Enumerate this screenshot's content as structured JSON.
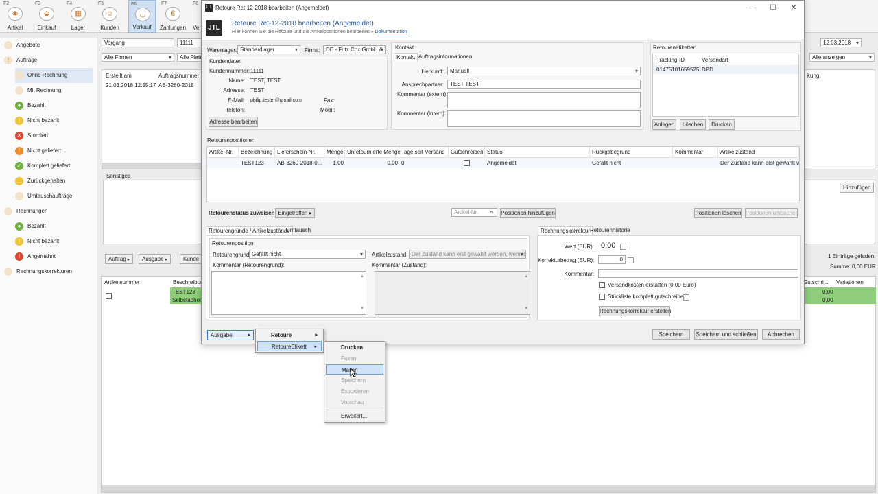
{
  "toolbar": {
    "items": [
      {
        "key": "F2",
        "label": "Artikel",
        "icon": "artikel-icon"
      },
      {
        "key": "F3",
        "label": "Einkauf",
        "icon": "einkauf-icon"
      },
      {
        "key": "F4",
        "label": "Lager",
        "icon": "lager-icon"
      },
      {
        "key": "F5",
        "label": "Kunden",
        "icon": "kunden-icon"
      },
      {
        "key": "F6",
        "label": "Verkauf",
        "icon": "verkauf-icon"
      },
      {
        "key": "F7",
        "label": "Zahlungen",
        "icon": "zahlungen-icon"
      },
      {
        "key": "F8",
        "label": "Ve",
        "icon": "versand-icon"
      }
    ]
  },
  "nav": {
    "items": [
      {
        "label": "Angebote",
        "color": "#e8a23a",
        "glyph": ""
      },
      {
        "label": "Aufträge",
        "color": "#e8a23a",
        "glyph": "!"
      },
      {
        "label": "Ohne Rechnung",
        "color": "#e8a23a",
        "glyph": ""
      },
      {
        "label": "Mit Rechnung",
        "color": "#e8a23a",
        "glyph": ""
      },
      {
        "label": "Bezahlt",
        "color": "#6fb23b",
        "glyph": "●"
      },
      {
        "label": "Nicht bezahlt",
        "color": "#f2c230",
        "glyph": "!"
      },
      {
        "label": "Storniert",
        "color": "#e0452f",
        "glyph": "✕"
      },
      {
        "label": "Nicht geliefert",
        "color": "#f08a24",
        "glyph": "!"
      },
      {
        "label": "Komplett geliefert",
        "color": "#6fb23b",
        "glyph": "✓"
      },
      {
        "label": "Zurückgehalten",
        "color": "#f2c230",
        "glyph": "…"
      },
      {
        "label": "Umtauschaufträge",
        "color": "#e8a23a",
        "glyph": ""
      },
      {
        "label": "Rechnungen",
        "color": "#e8a23a",
        "glyph": ""
      },
      {
        "label": "Bezahlt",
        "color": "#6fb23b",
        "glyph": "●"
      },
      {
        "label": "Nicht bezahlt",
        "color": "#f2c230",
        "glyph": "!"
      },
      {
        "label": "Angemahnt",
        "color": "#e0452f",
        "glyph": "!"
      },
      {
        "label": "Rechnungskorrekturen",
        "color": "#e8a23a",
        "glyph": ""
      }
    ]
  },
  "bg": {
    "vorgang": "Vorgang",
    "search_value": "11111",
    "alle_firmen": "Alle Firmen",
    "alle_plattf": "Alle Plattfo",
    "date": "12.03.2018",
    "alle_anzeigen": "Alle anzeigen",
    "col_erstellt": "Erstellt am",
    "col_auftragsnummer": "Auftragsnummer",
    "row_erstellt": "21.03.2018 12:55:17",
    "row_auftragsnummer": "AB-3260-2018",
    "col_right": "kung",
    "sonstiges": "Sonstiges",
    "btn_auftrag": "Auftrag",
    "btn_ausgabe": "Ausgabe",
    "btn_kunde": "Kunde",
    "btn_hinzufuegen": "Hinzufügen",
    "eintraege": "1 Einträge geladen.",
    "summe": "Summe: 0,00 EUR",
    "col_artikelnummer": "Artikelnummer",
    "col_beschreibung": "Beschreibung",
    "col_gutschrift": "Gutschri...",
    "col_variationen": "Variationen",
    "row1_desc": "TEST123",
    "row2_desc": "Selbstabholer",
    "row1_val": "0,00",
    "row2_val": "0,00"
  },
  "dialog": {
    "window_title": "Retoure Ret-12-2018 bearbeiten (Angemeldet)",
    "logo": "JTL",
    "heading": "Retoure Ret-12-2018 bearbeiten (Angemeldet)",
    "subheading": "Hier können Sie die Retoure und die Artikelpositionen bearbeiten  »",
    "doc_link": "Dokumentation",
    "warenlager_label": "Warenlager:",
    "warenlager_value": "Standardlager",
    "firma_label": "Firma:",
    "firma_value": "DE - Fritz Cox GmbH & C",
    "kundendaten": {
      "title": "Kundendaten",
      "kundennummer_label": "Kundennummer:",
      "kundennummer": "11111",
      "name_label": "Name:",
      "name": "TEST, TEST",
      "adresse_label": "Adresse:",
      "adresse": "TEST",
      "email_label": "E-Mail:",
      "email": "philip.tester@gmail.com",
      "telefon_label": "Telefon:",
      "fax_label": "Fax:",
      "mobil_label": "Mobil:",
      "edit_button": "Adresse bearbeiten"
    },
    "kontakt": {
      "title": "Kontakt",
      "tab_kontakt": "Kontakt",
      "tab_auftrag": "Auftragsinformationen",
      "herkunft_label": "Herkunft:",
      "herkunft": "Manuell",
      "ansprech_label": "Ansprechpartner:",
      "ansprech": "TEST TEST",
      "komm_extern_label": "Kommentar (extern):",
      "komm_intern_label": "Kommentar (intern):"
    },
    "etiketten": {
      "title": "Retourenetiketten",
      "col_tracking": "Tracking-ID",
      "col_versandart": "Versandart",
      "tracking": "01475101659525",
      "versandart": "DPD",
      "btn_anlegen": "Anlegen",
      "btn_loeschen": "Löschen",
      "btn_drucken": "Drucken"
    },
    "positionen": {
      "title": "Retourenpositionen",
      "cols": [
        "Artikel-Nr.",
        "Bezeichnung",
        "Lieferschein-Nr.",
        "Menge",
        "Unretournierte Menge",
        "Tage seit Versand",
        "Gutschreiben",
        "Status",
        "Rückgabegrund",
        "Kommentar",
        "Artikelzustand"
      ],
      "row": {
        "artikel": "",
        "bezeichnung": "TEST123",
        "lieferschein": "AB-3260-2018-0...",
        "menge": "1,00",
        "unretourniert": "0,00",
        "tage": "0",
        "status": "Angemeldet",
        "rueckgabegrund": "Gefällt nicht",
        "kommentar": "",
        "zustand": "Der Zustand kann erst gewählt w..."
      },
      "status_label": "Retourenstatus zuweisen:",
      "status_button": "Eingetroffen",
      "artikel_placeholder": "Artikel-Nr.",
      "btn_hinzufuegen": "Positionen hinzufügen",
      "btn_loeschen": "Positionen löschen",
      "btn_zustand": "Positionen umbuchen"
    },
    "gruende": {
      "tab1": "Retourengründe / Artikelzustände",
      "tab2": "Umtausch",
      "group": "Retourenposition",
      "grund_label": "Retourengrund:",
      "grund": "Gefällt nicht",
      "zustand_label": "Artikelzustand:",
      "zustand": "Der Zustand kann erst gewählt werden, wenn der",
      "komm_grund_label": "Kommentar (Retourengrund):",
      "komm_zustand_label": "Kommentar (Zustand):"
    },
    "korrektur": {
      "tab1": "Rechnungskorrektur",
      "tab2": "Retourenhistorie",
      "wert_label": "Wert (EUR):",
      "wert": "0,00",
      "betrag_label": "Korrekturbetrag (EUR):",
      "betrag": "0",
      "kommentar_label": "Kommentar:",
      "versand_label": "Versandkosten erstatten (0,00 Euro)",
      "stueck_label": "Stückliste komplett gutschreiben",
      "btn_erstellen": "Rechnungskorrektur erstellen"
    },
    "footer": {
      "ausgabe": "Ausgabe",
      "speichern": "Speichern",
      "speichern_schliessen": "Speichern und schließen",
      "abbrechen": "Abbrechen"
    }
  },
  "menus": {
    "level1": [
      "Retoure",
      "RetoureEtikett"
    ],
    "level2": [
      {
        "label": "Drucken",
        "state": "bold"
      },
      {
        "label": "Faxen",
        "state": "disabled"
      },
      {
        "label": "Mailen",
        "state": "highlight"
      },
      {
        "label": "Speichern",
        "state": "disabled"
      },
      {
        "label": "Exportieren",
        "state": "disabled"
      },
      {
        "label": "Vorschau",
        "state": "disabled"
      },
      {
        "label": "Erweitert...",
        "state": "normal"
      }
    ]
  }
}
